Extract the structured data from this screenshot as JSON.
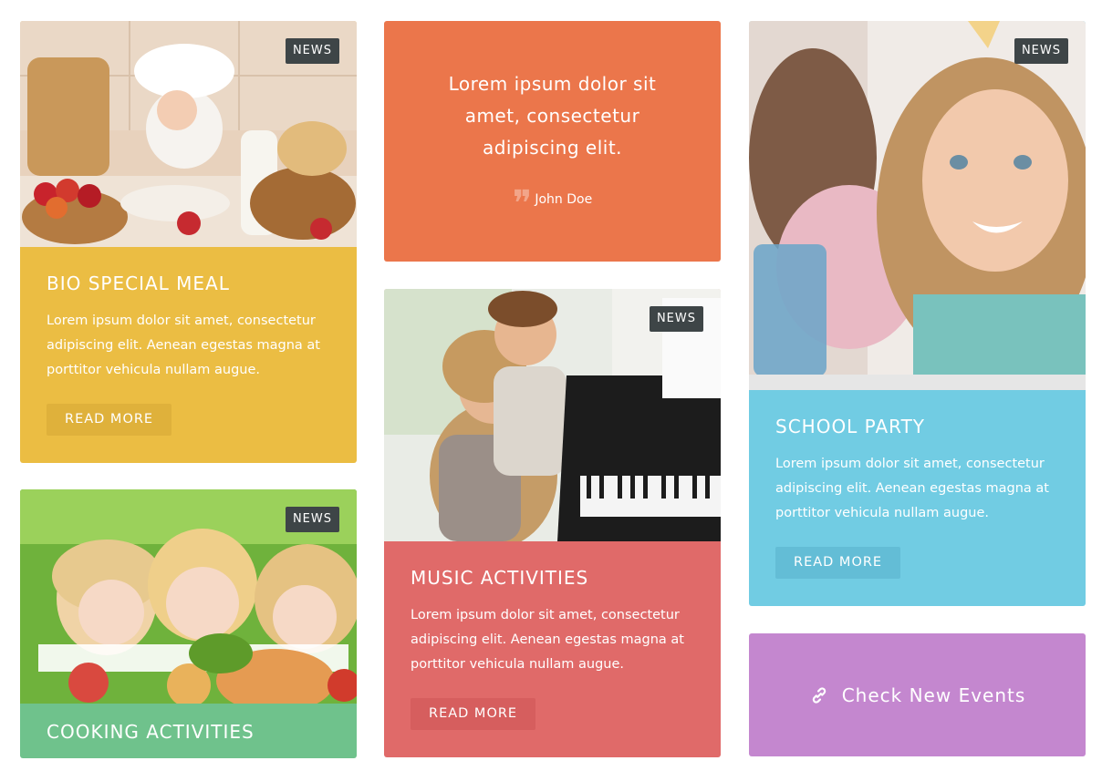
{
  "colors": {
    "yellow": "#ebbd43",
    "orange": "#eb764b",
    "red": "#e06a69",
    "green": "#6fc28c",
    "blue": "#71cce3",
    "purple": "#c487cf",
    "badge": "#3e4547"
  },
  "badge_label": "NEWS",
  "cards": {
    "bio": {
      "title": "BIO SPECIAL MEAL",
      "text": "Lorem ipsum dolor sit amet, consectetur adipiscing elit. Aenean egestas magna at porttitor vehicula nullam augue.",
      "button": "READ MORE"
    },
    "cooking": {
      "title": "COOKING ACTIVITIES"
    },
    "quote": {
      "text": "Lorem ipsum dolor sit amet, consectetur adipiscing elit.",
      "author": "John Doe"
    },
    "music": {
      "title": "MUSIC ACTIVITIES",
      "text": "Lorem ipsum dolor sit amet, consectetur adipiscing elit. Aenean egestas magna at porttitor vehicula nullam augue.",
      "button": "READ MORE"
    },
    "party": {
      "title": "SCHOOL PARTY",
      "text": "Lorem ipsum dolor sit amet, consectetur adipiscing elit. Aenean egestas magna at porttitor vehicula nullam augue.",
      "button": "READ MORE"
    },
    "events": {
      "label": "Check New Events",
      "icon": "link-icon"
    }
  }
}
